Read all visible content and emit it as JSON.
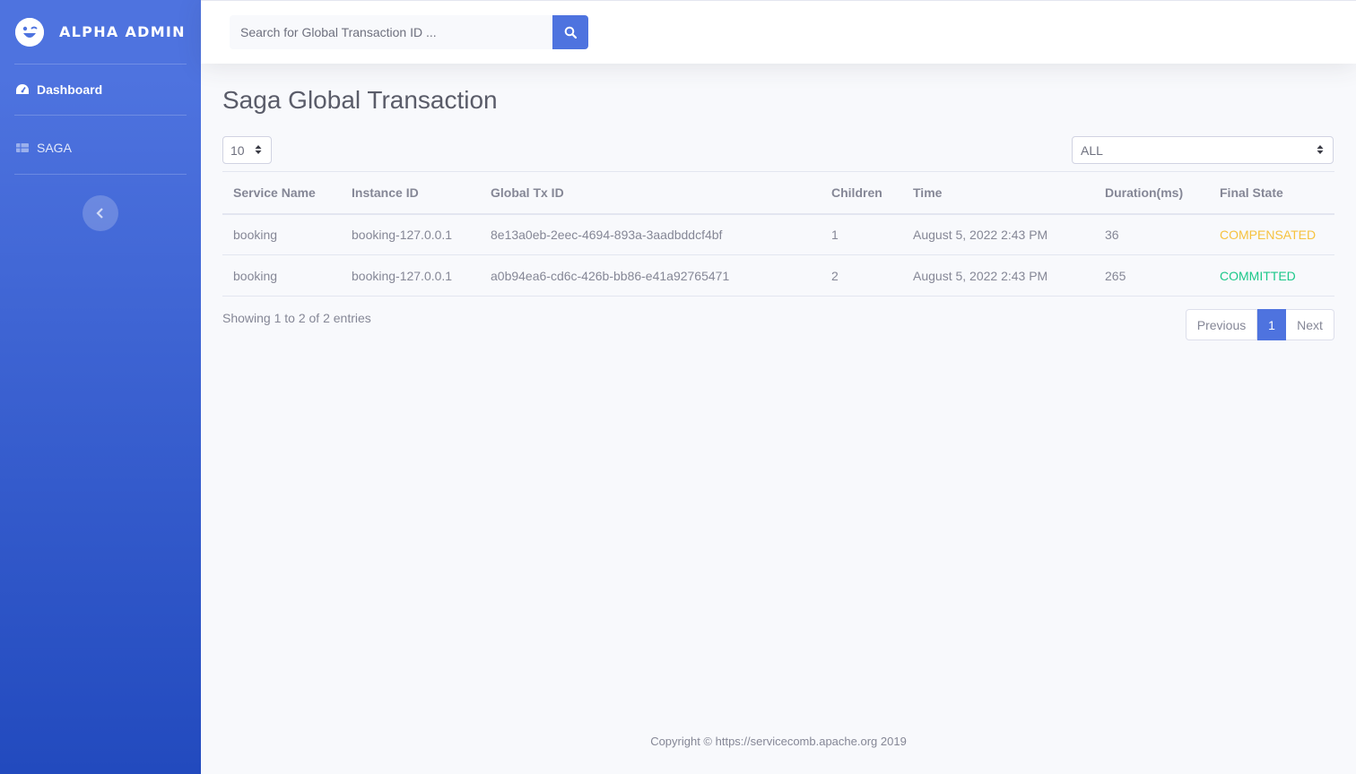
{
  "brand": {
    "name": "ALPHA ADMIN"
  },
  "sidebar": {
    "items": [
      {
        "label": "Dashboard",
        "icon": "tachometer-icon",
        "active": true
      },
      {
        "label": "SAGA",
        "icon": "table-icon",
        "active": false
      }
    ],
    "toggle_icon": "chevron-left-icon"
  },
  "search": {
    "placeholder": "Search for Global Transaction ID ...",
    "icon": "search-icon"
  },
  "page": {
    "title": "Saga Global Transaction"
  },
  "controls": {
    "page_length": "10",
    "state_filter": "ALL"
  },
  "table": {
    "columns": [
      "Service Name",
      "Instance ID",
      "Global Tx ID",
      "Children",
      "Time",
      "Duration(ms)",
      "Final State"
    ],
    "rows": [
      {
        "service": "booking",
        "instance": "booking-127.0.0.1",
        "global_tx": "8e13a0eb-2eec-4694-893a-3aadbddcf4bf",
        "children": "1",
        "time": "August 5, 2022 2:43 PM",
        "duration": "36",
        "state": "COMPENSATED"
      },
      {
        "service": "booking",
        "instance": "booking-127.0.0.1",
        "global_tx": "a0b94ea6-cd6c-426b-bb86-e41a92765471",
        "children": "2",
        "time": "August 5, 2022 2:43 PM",
        "duration": "265",
        "state": "COMMITTED"
      }
    ]
  },
  "info": "Showing 1 to 2 of 2 entries",
  "pagination": {
    "previous": "Previous",
    "current": "1",
    "next": "Next"
  },
  "footer": "Copyright © https://servicecomb.apache.org 2019",
  "colors": {
    "primary": "#4e73df",
    "warning": "#f6c23e",
    "success": "#1cc88a"
  }
}
